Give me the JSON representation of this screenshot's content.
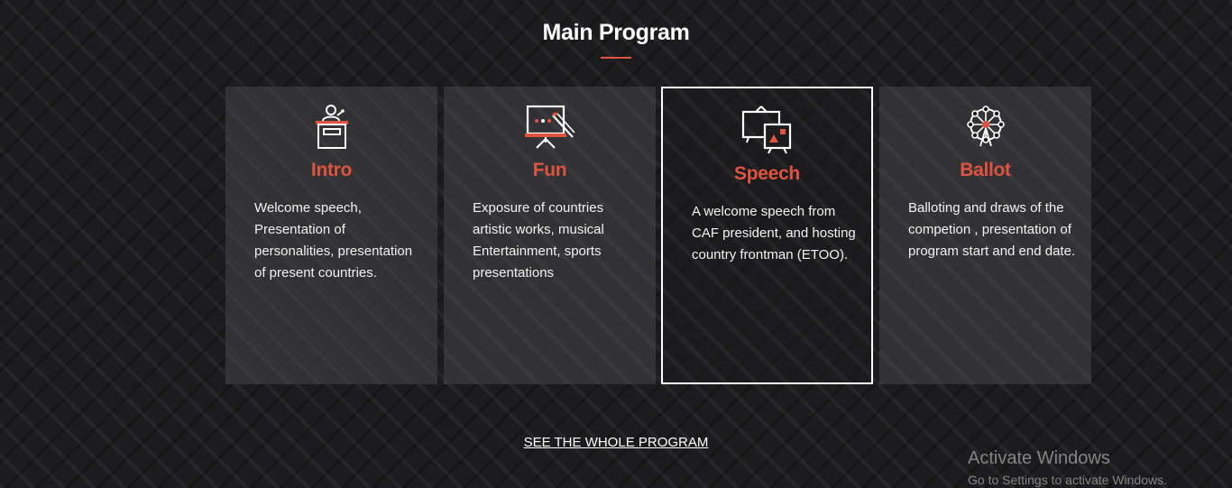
{
  "section": {
    "title": "Main Program"
  },
  "cards": [
    {
      "title": "Intro",
      "icon": "podium-icon",
      "text": "Welcome speech, Presentation of personalities, presentation of present countries."
    },
    {
      "title": "Fun",
      "icon": "easel-presentation-icon",
      "text": "Exposure of countries artistic works, musical Entertainment, sports presentations"
    },
    {
      "title": "Speech",
      "icon": "slideshow-icon",
      "text": "A welcome speech from CAF president, and hosting country frontman (ETOO).",
      "active": true
    },
    {
      "title": "Ballot",
      "icon": "ferris-wheel-icon",
      "text": "Balloting and draws of the competion , presentation of program start and end date."
    }
  ],
  "link": {
    "label": "SEE THE WHOLE PROGRAM"
  },
  "watermark": {
    "title": "Activate Windows",
    "subtitle": "Go to Settings to activate Windows."
  },
  "colors": {
    "accent": "#e0533f",
    "background": "#1c1c1e",
    "card": "#3c3c3e"
  }
}
